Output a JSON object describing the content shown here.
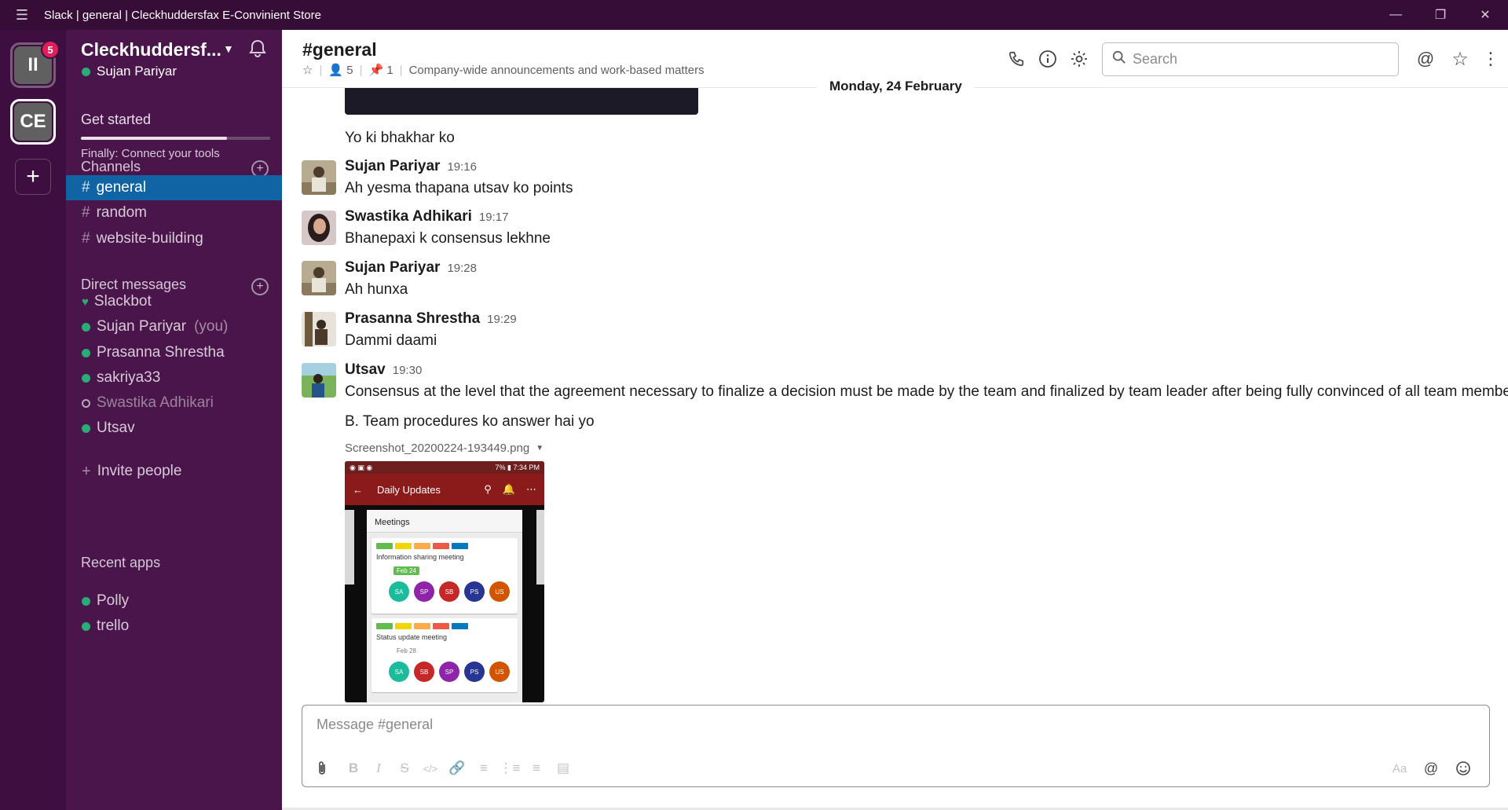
{
  "window": {
    "title": "Slack | general | Cleckhuddersfax E-Convinient Store"
  },
  "rail": {
    "workspaces": [
      {
        "initials": "II",
        "badge": "5"
      },
      {
        "initials": "CE"
      }
    ],
    "add_label": "+"
  },
  "sidebar": {
    "team_name": "Cleckhuddersf...",
    "user_name": "Sujan Pariyar",
    "get_started": "Get started",
    "get_started_progress": 0.77,
    "connect_tools": "Finally: Connect your tools",
    "channels_heading": "Channels",
    "channels": [
      {
        "name": "general",
        "active": true
      },
      {
        "name": "random"
      },
      {
        "name": "website-building"
      }
    ],
    "dm_heading": "Direct messages",
    "dms": [
      {
        "name": "Slackbot",
        "status": "heart"
      },
      {
        "name": "Sujan Pariyar",
        "suffix": "(you)",
        "status": "online"
      },
      {
        "name": "Prasanna Shrestha",
        "status": "online"
      },
      {
        "name": "sakriya33",
        "status": "online"
      },
      {
        "name": "Swastika Adhikari",
        "status": "away"
      },
      {
        "name": "Utsav",
        "status": "online"
      }
    ],
    "invite": "Invite people",
    "apps_heading": "Recent apps",
    "apps": [
      {
        "name": "Polly"
      },
      {
        "name": "trello"
      }
    ]
  },
  "channel": {
    "title": "#general",
    "members": "5",
    "pinned": "1",
    "topic": "Company-wide announcements and work-based matters"
  },
  "search": {
    "placeholder": "Search"
  },
  "messages": {
    "date": "Monday, 24 February",
    "first_text": "Yo ki bhakhar ko",
    "items": [
      {
        "author": "Sujan Pariyar",
        "time": "19:16",
        "text": "Ah yesma thapana utsav ko points"
      },
      {
        "author": "Swastika Adhikari",
        "time": "19:17",
        "text": "Bhanepaxi k consensus lekhne"
      },
      {
        "author": "Sujan Pariyar",
        "time": "19:28",
        "text": "Ah hunxa"
      },
      {
        "author": "Prasanna Shrestha",
        "time": "19:29",
        "text": "Dammi daami"
      },
      {
        "author": "Utsav",
        "time": "19:30",
        "text": "Consensus at the level that the agreement necessary to finalize a decision must be made by the team and finalized by team leader after being fully convinced of all team members."
      }
    ],
    "followup_text": "B. Team procedures ko answer hai yo",
    "file_name": "Screenshot_20200224-193449.png"
  },
  "attachment": {
    "status_time": "7:34 PM",
    "status_battery": "7%",
    "bar_title": "Daily Updates",
    "column_title": "Meetings",
    "cards": [
      {
        "title": "Information sharing meeting",
        "due": "Feb 24",
        "avatars": [
          "SA",
          "SP",
          "SB",
          "PS",
          "US"
        ]
      },
      {
        "title": "Status update meeting",
        "due": "Feb 28",
        "avatars": [
          "SA",
          "SB",
          "SP",
          "PS",
          "US"
        ]
      }
    ],
    "label_colors": [
      "#61bd4f",
      "#f2d600",
      "#ffab4a",
      "#eb5a46",
      "#0079bf"
    ]
  },
  "composer": {
    "placeholder": "Message #general",
    "text_style_label": "Aa"
  },
  "colors": {
    "titlebar": "#350d36",
    "rail": "#3f0e40",
    "sidebar": "#4a154b",
    "active_channel": "#1164a3",
    "online": "#2bac76",
    "badge": "#e01e5a"
  }
}
